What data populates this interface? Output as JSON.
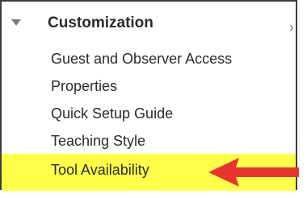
{
  "section": {
    "title": "Customization",
    "expand_icon": "caret-down-icon",
    "chevron_icon": "chevron-right-icon",
    "chevron_glyph": "›"
  },
  "items": [
    {
      "label": "Guest and Observer Access"
    },
    {
      "label": "Properties"
    },
    {
      "label": "Quick Setup Guide"
    },
    {
      "label": "Teaching Style"
    },
    {
      "label": "Tool Availability",
      "highlighted": true
    }
  ],
  "colors": {
    "highlight": "#ffff4a",
    "arrow": "#e8342e",
    "border": "#3d3d3d"
  }
}
